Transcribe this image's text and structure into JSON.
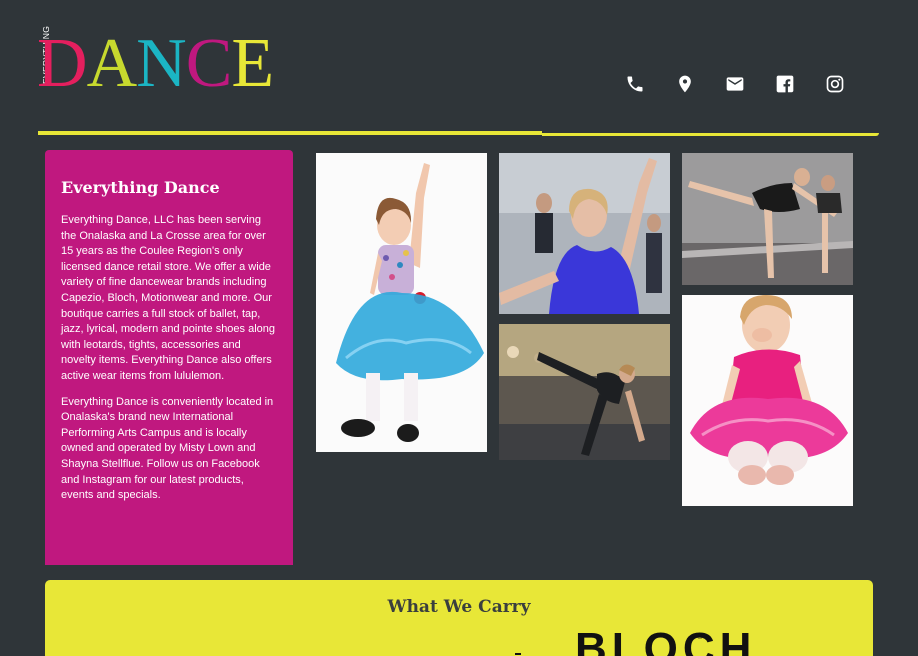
{
  "logo": {
    "small_text": "EVERYTHING",
    "letters": [
      "D",
      "A",
      "N",
      "C",
      "E"
    ],
    "colors": [
      "#e41f5e",
      "#e8e737",
      "#1bb5c4",
      "#c0187f",
      "#e8e737"
    ]
  },
  "header_icons": [
    "phone-icon",
    "location-icon",
    "mail-icon",
    "facebook-icon",
    "instagram-icon"
  ],
  "about": {
    "title": "Everything Dance",
    "para1": "Everything Dance, LLC has been serving the Onalaska and La Crosse area for over 15 years as the Coulee Region's only licensed dance retail store. We offer a wide variety of fine dancewear brands including Capezio, Bloch, Motionwear and more. Our boutique carries a full stock of ballet, tap, jazz, lyrical, modern and pointe shoes along with leotards, tights, accessories and novelty items. Everything Dance also offers active wear items from lululemon.",
    "para2": "Everything Dance is conveniently located in Onalaska's brand new International Performing Arts Campus and is locally owned and operated by Misty Lown and Shayna Stellflue. Follow us on Facebook and Instagram for our latest products, events and specials."
  },
  "carry": {
    "title": "What We Carry",
    "brand": "BLOCH",
    "reg": "®"
  },
  "colors": {
    "background": "#2f3539",
    "magenta": "#c0187f",
    "yellow": "#e8e737",
    "teal": "#1bb5c4",
    "red": "#e41f5e"
  }
}
